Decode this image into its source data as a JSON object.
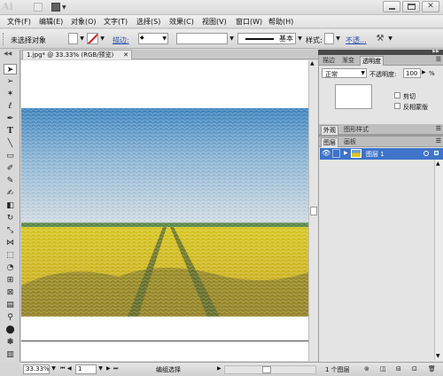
{
  "app": {
    "logo": "Ai"
  },
  "menu": {
    "items": [
      "文件(F)",
      "编辑(E)",
      "对象(O)",
      "文字(T)",
      "选择(S)",
      "效果(C)",
      "视图(V)",
      "窗口(W)",
      "帮助(H)"
    ]
  },
  "control_bar": {
    "selection": "未选择对象",
    "stroke_label": "描边:",
    "stroke_style": "基本",
    "style_label": "样式:",
    "opacity_link": "不透..."
  },
  "document": {
    "tab": "1.jpg* @ 33.33% (RGB/预览)"
  },
  "status_bar": {
    "zoom": "33.33%",
    "artboard": "1",
    "mode": "编组选择"
  },
  "panel_top": {
    "tabs": [
      "描边",
      "渐变",
      "透明度"
    ],
    "blend_mode": "正常",
    "opacity_label": "不透明度:",
    "opacity_value": "100",
    "opacity_unit": "%",
    "clip": "剪切",
    "invert_mask": "反相蒙版"
  },
  "panel_appearance": {
    "tabs": [
      "外观",
      "图形样式"
    ]
  },
  "panel_layers": {
    "tabs": [
      "图层",
      "画板"
    ],
    "layers": [
      {
        "name": "图层 1"
      }
    ],
    "count": "1 个图层"
  },
  "colors": {
    "selection": "#3e74c9",
    "sky_top": "#3f86c0",
    "field": "#d9c824"
  }
}
